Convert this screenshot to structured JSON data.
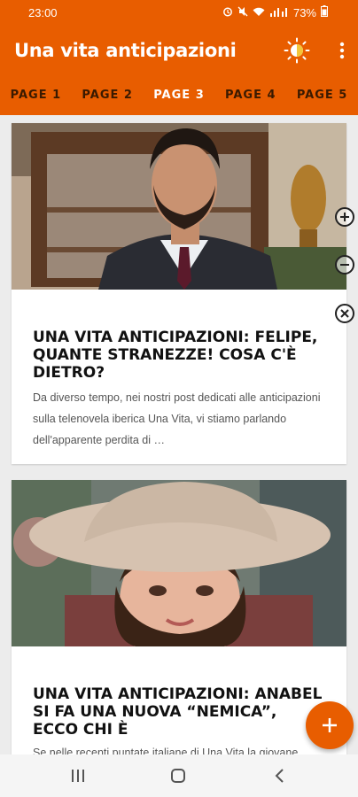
{
  "status": {
    "time": "23:00",
    "battery": "73%"
  },
  "appbar": {
    "title": "Una vita anticipazioni"
  },
  "tabs": [
    {
      "label": "PAGE 1",
      "active": false
    },
    {
      "label": "PAGE 2",
      "active": false
    },
    {
      "label": "PAGE 3",
      "active": true
    },
    {
      "label": "PAGE 4",
      "active": false
    },
    {
      "label": "PAGE 5",
      "active": false
    }
  ],
  "articles": [
    {
      "title": "UNA VITA ANTICIPAZIONI: FELIPE, QUANTE STRANEZZE! COSA C'È DIETRO?",
      "excerpt": "Da diverso tempo, nei nostri post dedicati alle anticipazioni sulla telenovela iberica Una Vita, vi stiamo parlando dell'apparente perdita di …"
    },
    {
      "title": "UNA VITA ANTICIPAZIONI: ANABEL SI FA UNA NUOVA “NEMICA”, ECCO CHI È",
      "excerpt": "Se nelle recenti puntate italiane di Una Vita la giovane"
    }
  ],
  "colors": {
    "accent": "#e85d00"
  }
}
